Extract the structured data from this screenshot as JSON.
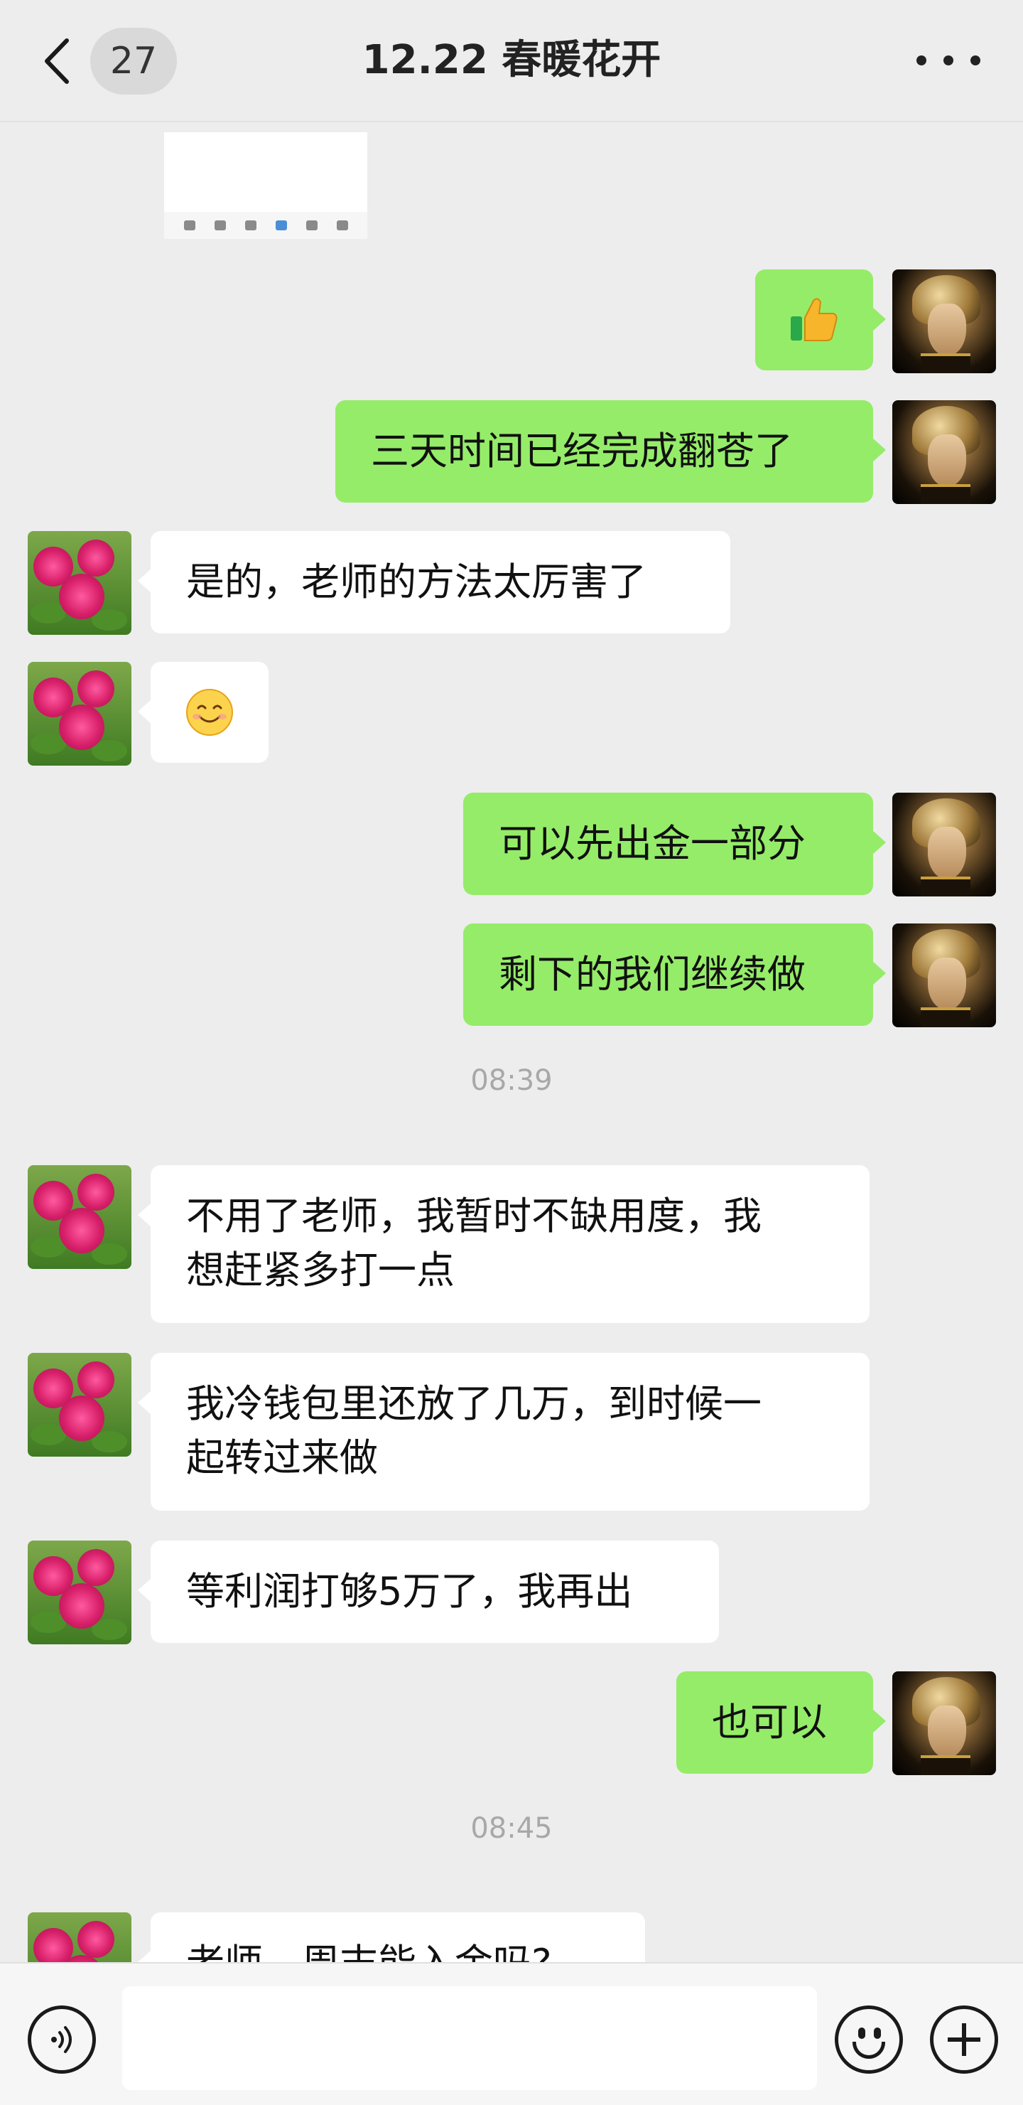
{
  "header": {
    "back_icon": "chevron-left-icon",
    "unread_count": "27",
    "title": "12.22 春暖花开",
    "more_icon": "more-horizontal-icon"
  },
  "messages": [
    {
      "side": "theirs",
      "type": "card-preview"
    },
    {
      "side": "mine",
      "type": "emoji",
      "text": "👍"
    },
    {
      "side": "mine",
      "type": "text",
      "text": "三天时间已经完成翻苍了"
    },
    {
      "side": "theirs",
      "type": "text",
      "text": "是的，老师的方法太厉害了"
    },
    {
      "side": "theirs",
      "type": "emoji",
      "text": "😊"
    },
    {
      "side": "mine",
      "type": "text",
      "text": "可以先出金一部分"
    },
    {
      "side": "mine",
      "type": "text",
      "text": "剩下的我们继续做"
    },
    {
      "type": "timestamp",
      "text": "08:39"
    },
    {
      "side": "theirs",
      "type": "text",
      "lines": [
        "不用了老师，我暂时不缺用度，我",
        "想赶紧多打一点"
      ]
    },
    {
      "side": "theirs",
      "type": "text",
      "lines": [
        "我冷钱包里还放了几万，到时候一",
        "起转过来做"
      ]
    },
    {
      "side": "theirs",
      "type": "text",
      "text": "等利润打够5万了，我再出"
    },
    {
      "side": "mine",
      "type": "text",
      "text": "也可以"
    },
    {
      "type": "timestamp",
      "text": "08:45"
    },
    {
      "side": "theirs",
      "type": "text",
      "text": "老师，周末能入金吗?"
    }
  ],
  "input_bar": {
    "voice_icon": "voice-icon",
    "text_value": "",
    "emoji_icon": "emoji-icon",
    "plus_icon": "plus-icon"
  },
  "colors": {
    "background": "#ededed",
    "my_bubble": "#95ec69",
    "their_bubble": "#ffffff",
    "timestamp": "#a8a8a8"
  }
}
